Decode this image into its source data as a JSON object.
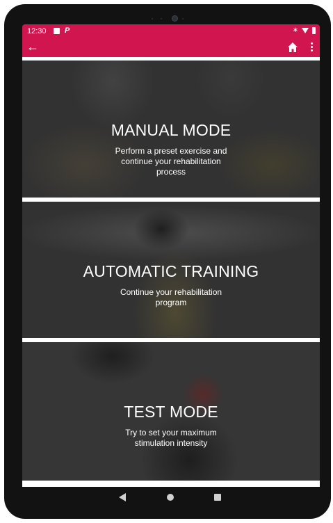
{
  "status_bar": {
    "time": "12:30",
    "icons": [
      "image-icon",
      "parking-icon",
      "bluetooth-icon",
      "wifi-icon",
      "battery-icon"
    ],
    "p_glyph": "P",
    "bt_glyph": "∗"
  },
  "app_bar": {
    "color": "#d0154f",
    "back_glyph": "←",
    "actions": [
      "home-icon",
      "more-icon"
    ]
  },
  "cards": [
    {
      "title": "MANUAL MODE",
      "desc": "Perform a preset exercise and\ncontinue your rehabilitation\nprocess"
    },
    {
      "title": "AUTOMATIC TRAINING",
      "desc": "Continue your rehabilitation\nprogram"
    },
    {
      "title": "TEST MODE",
      "desc": "Try to set your maximum\nstimulation intensity"
    }
  ],
  "nav_bar": {
    "buttons": [
      "back-icon",
      "home-icon",
      "recents-icon"
    ]
  }
}
